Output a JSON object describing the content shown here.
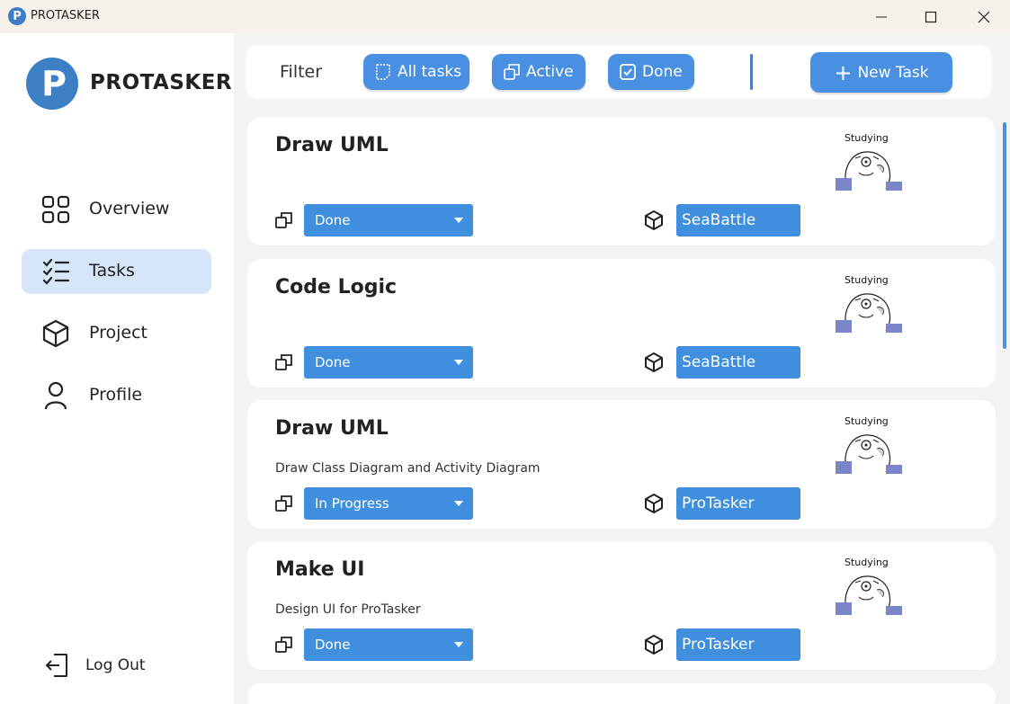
{
  "window": {
    "title": "PROTASKER",
    "minimize_icon": "minimize-icon",
    "maximize_icon": "maximize-icon",
    "close_icon": "close-icon"
  },
  "sidebar": {
    "logo_letter": "P",
    "brand": "PROTASKER",
    "items": [
      {
        "label": "Overview",
        "icon": "grid-icon",
        "active": false
      },
      {
        "label": "Tasks",
        "icon": "checklist-icon",
        "active": true
      },
      {
        "label": "Project",
        "icon": "cube-icon",
        "active": false
      },
      {
        "label": "Profile",
        "icon": "user-icon",
        "active": false
      }
    ],
    "logout_label": "Log Out"
  },
  "filter": {
    "label": "Filter",
    "buttons": [
      {
        "label": "All tasks",
        "icon": "note-icon"
      },
      {
        "label": "Active",
        "icon": "copy-icon"
      },
      {
        "label": "Done",
        "icon": "checkbox-icon"
      }
    ],
    "new_task_label": "New Task"
  },
  "tasks": [
    {
      "title": "Draw UML",
      "description": "",
      "status": "Done",
      "project": "SeaBattle",
      "sticker_text": "Studying"
    },
    {
      "title": "Code Logic",
      "description": "",
      "status": "Done",
      "project": "SeaBattle",
      "sticker_text": "Studying"
    },
    {
      "title": "Draw UML",
      "description": "Draw Class Diagram and Activity Diagram",
      "status": "In Progress",
      "project": "ProTasker",
      "sticker_text": "Studying"
    },
    {
      "title": "Make UI",
      "description": "Design UI for ProTasker",
      "status": "Done",
      "project": "ProTasker",
      "sticker_text": "Studying"
    }
  ],
  "colors": {
    "accent": "#4a90e2",
    "select_bg": "#3f8fde",
    "active_nav": "#d6e6f8",
    "logo": "#3d7fc4"
  }
}
